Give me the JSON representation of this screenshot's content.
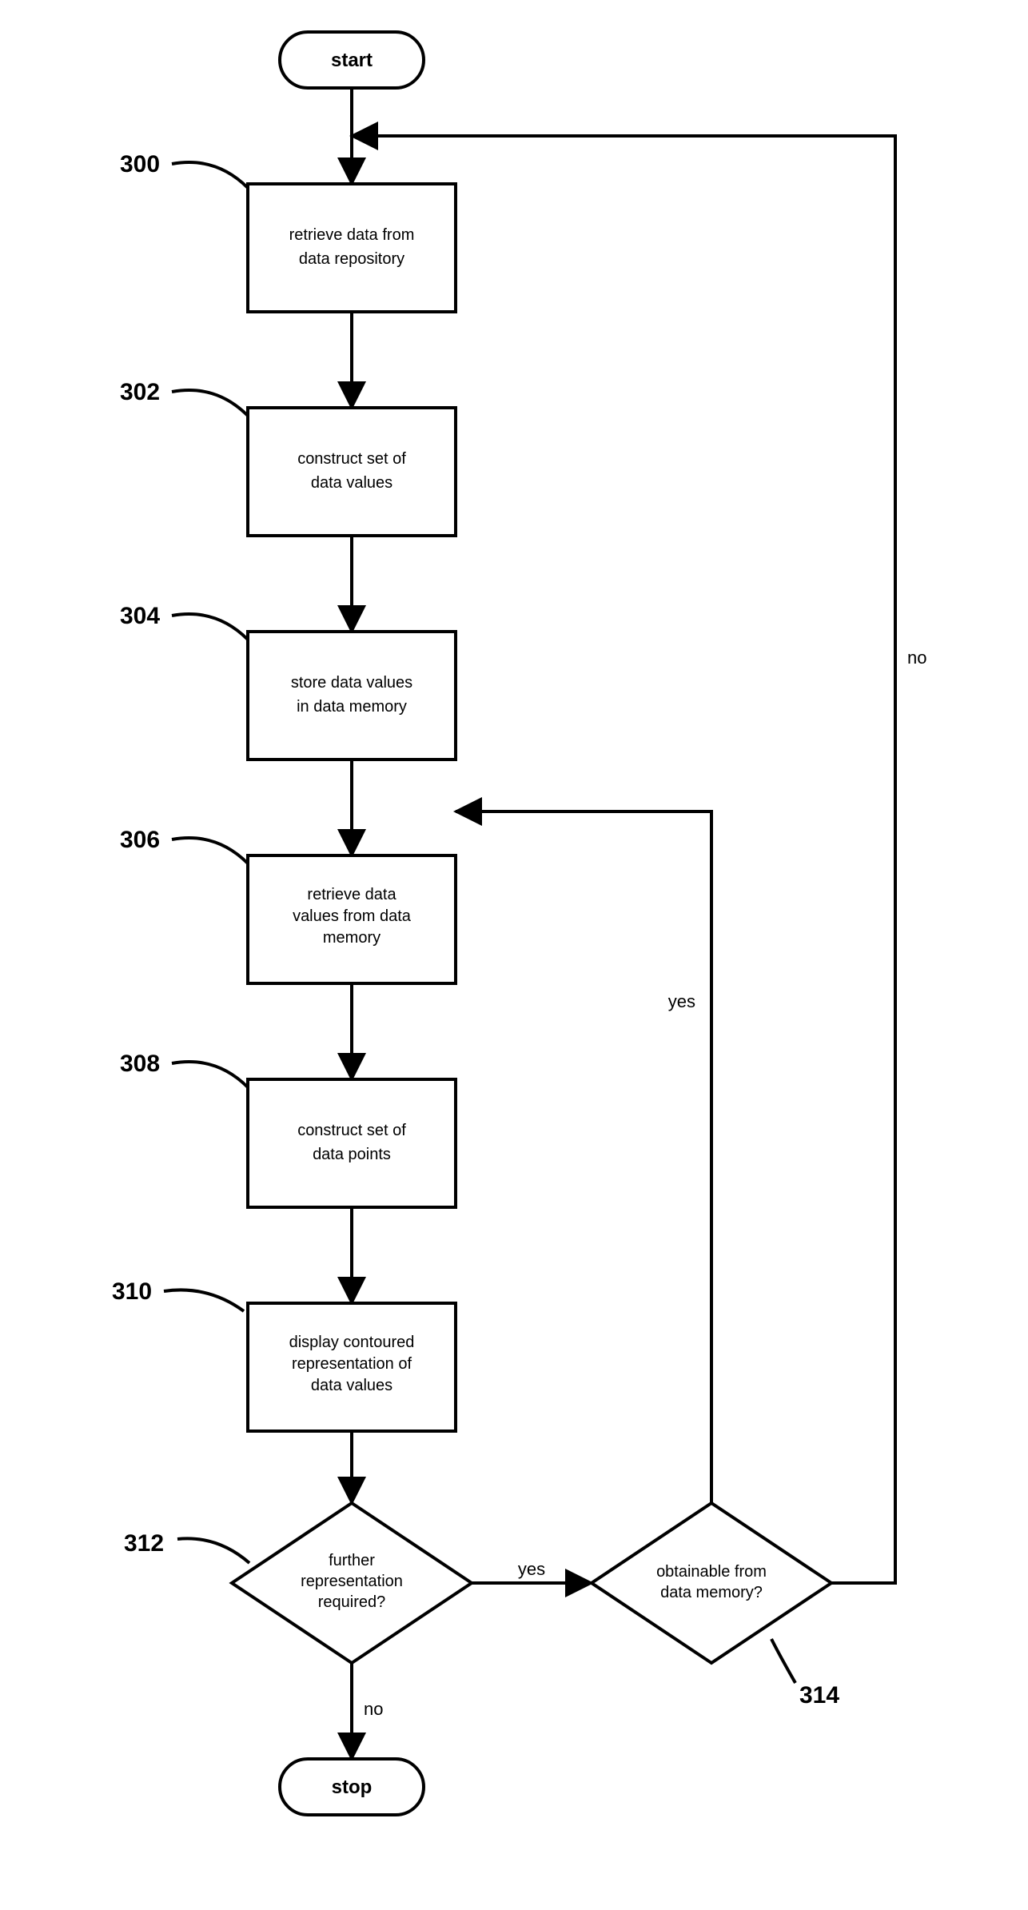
{
  "terminals": {
    "start": "start",
    "stop": "stop"
  },
  "steps": {
    "s300": {
      "label": "300",
      "text1": "retrieve data from",
      "text2": "data repository"
    },
    "s302": {
      "label": "302",
      "text1": "construct set of",
      "text2": "data values"
    },
    "s304": {
      "label": "304",
      "text1": "store data values",
      "text2": "in data memory"
    },
    "s306": {
      "label": "306",
      "text1": "retrieve data",
      "text2": "values from data",
      "text3": "memory"
    },
    "s308": {
      "label": "308",
      "text1": "construct set of",
      "text2": "data points"
    },
    "s310": {
      "label": "310",
      "text1": "display contoured",
      "text2": "representation of",
      "text3": "data values"
    }
  },
  "decisions": {
    "d312": {
      "label": "312",
      "text1": "further",
      "text2": "representation",
      "text3": "required?"
    },
    "d314": {
      "label": "314",
      "text1": "obtainable from",
      "text2": "data memory?"
    }
  },
  "edges": {
    "yes": "yes",
    "no": "no"
  }
}
